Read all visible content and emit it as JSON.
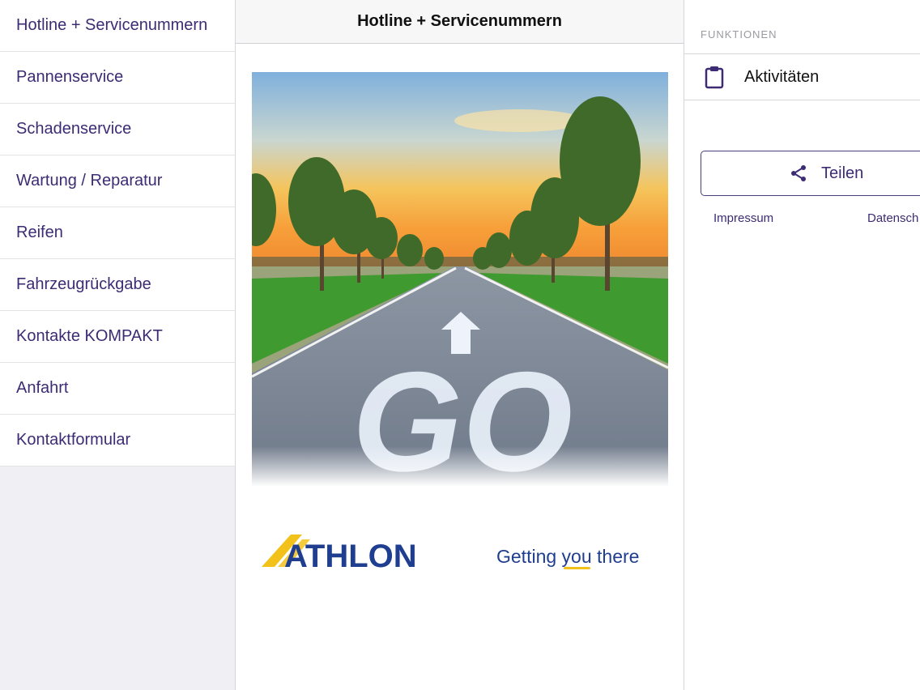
{
  "sidebar": {
    "items": [
      {
        "label": "Hotline + Servicenummern"
      },
      {
        "label": "Pannenservice"
      },
      {
        "label": "Schadenservice"
      },
      {
        "label": "Wartung / Reparatur"
      },
      {
        "label": "Reifen"
      },
      {
        "label": "Fahrzeugrückgabe"
      },
      {
        "label": "Kontakte KOMPAKT"
      },
      {
        "label": "Anfahrt"
      },
      {
        "label": "Kontaktformular"
      }
    ]
  },
  "center": {
    "title": "Hotline + Servicenummern",
    "road_text": "GO",
    "brand_name": "ATHLON",
    "tagline_pre": "Getting ",
    "tagline_you": "you",
    "tagline_post": " there"
  },
  "right": {
    "section_label": "FUNKTIONEN",
    "activities_label": "Aktivitäten",
    "share_label": "Teilen",
    "impressum_label": "Impressum",
    "datenschutz_label": "Datensch"
  },
  "colors": {
    "accent": "#3d2c73",
    "brand_blue": "#1f3e8f",
    "brand_yellow": "#f2c21b"
  }
}
